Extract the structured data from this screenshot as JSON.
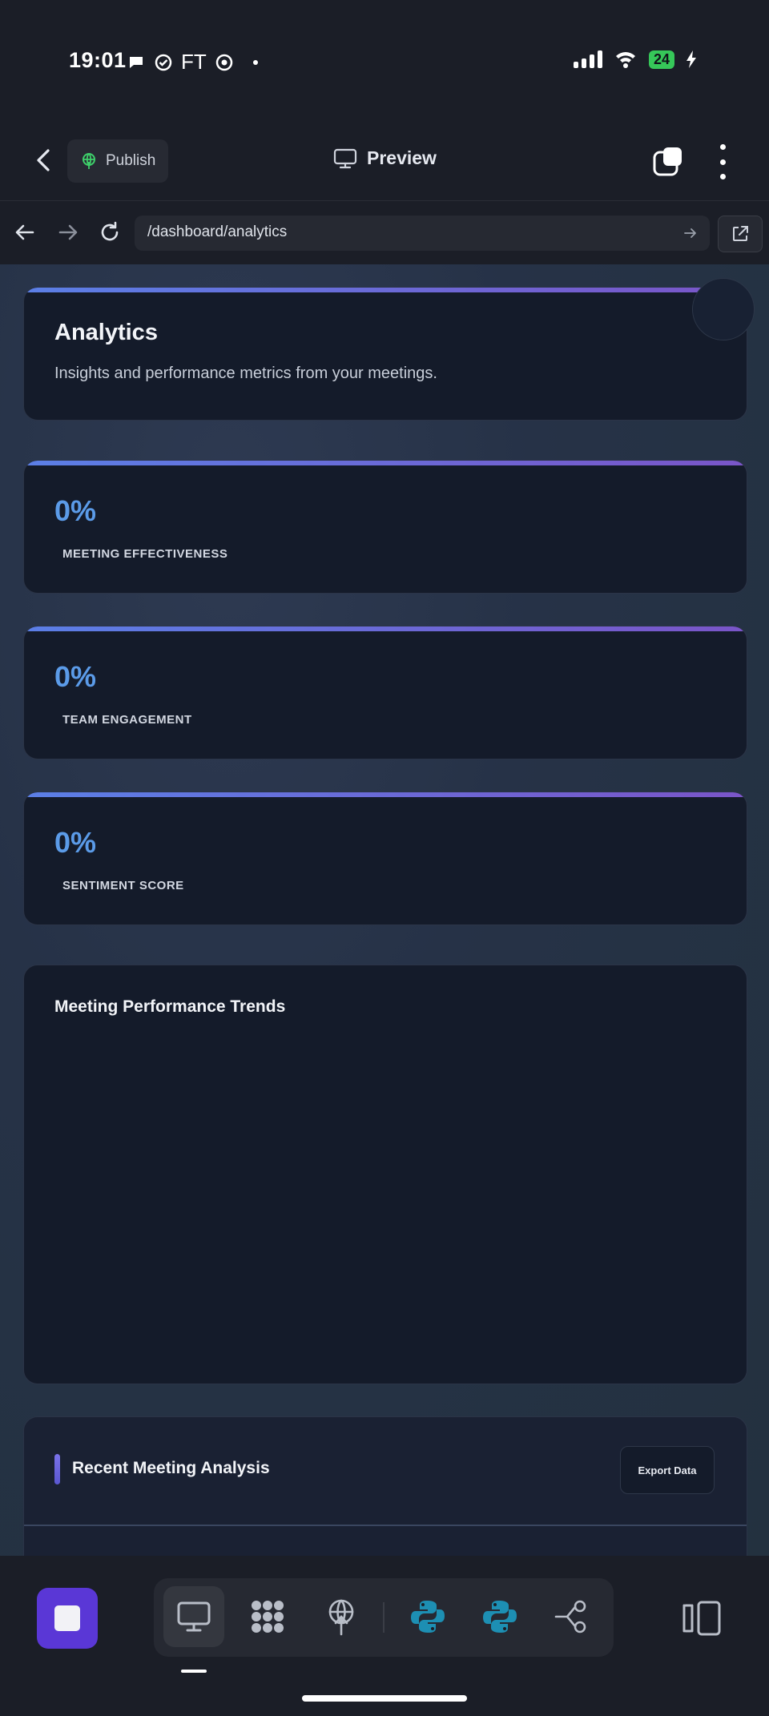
{
  "status_bar": {
    "time": "19:01",
    "carrier_text": "FT",
    "battery": "24"
  },
  "app_bar": {
    "publish_label": "Publish",
    "preview_label": "Preview"
  },
  "url_bar": {
    "url": "/dashboard/analytics"
  },
  "header_card": {
    "title": "Analytics",
    "subtitle": "Insights and performance metrics from your meetings."
  },
  "metrics": [
    {
      "value": "0%",
      "label": "MEETING EFFECTIVENESS"
    },
    {
      "value": "0%",
      "label": "TEAM ENGAGEMENT"
    },
    {
      "value": "0%",
      "label": "SENTIMENT SCORE"
    }
  ],
  "trends_card": {
    "title": "Meeting Performance Trends"
  },
  "recent_card": {
    "title": "Recent Meeting Analysis",
    "export_label": "Export Data"
  },
  "colors": {
    "accent_start": "#5b7fe6",
    "accent_end": "#7a55c8",
    "metric_value": "#5b9be8",
    "stop_button": "#5a37d6",
    "python_icon": "#1d8fb3"
  },
  "icons": {
    "status": [
      "chat-bubble-icon",
      "check-circle-icon",
      "soccer-ball-icon",
      "dot-icon",
      "signal-icon",
      "wifi-icon",
      "battery-icon"
    ],
    "dock": [
      "monitor-icon",
      "cluster-icon",
      "antenna-icon",
      "python-icon",
      "python-icon",
      "branch-icon"
    ]
  }
}
